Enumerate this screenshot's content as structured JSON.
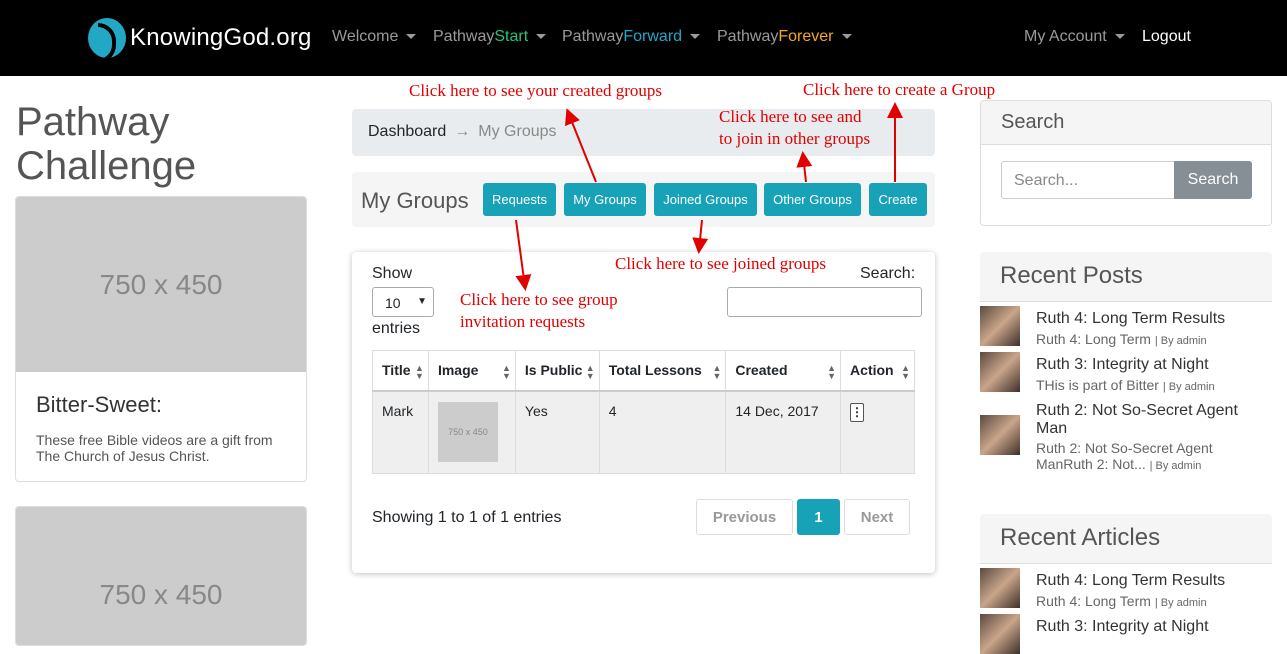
{
  "navbar": {
    "brand": "KnowingGod.org",
    "welcome": "Welcome",
    "pathway_start_prefix": "Pathway",
    "pathway_start_suffix": "Start",
    "pathway_forward_prefix": "Pathway",
    "pathway_forward_suffix": "Forward",
    "pathway_forever_prefix": "Pathway",
    "pathway_forever_suffix": "Forever",
    "my_account": "My Account",
    "logout": "Logout"
  },
  "left": {
    "title_line1": "Pathway",
    "title_line2": "Challenge",
    "card1_placeholder": "750 x 450",
    "card1_title": "Bitter-Sweet:",
    "card1_text": "These free Bible videos are a gift from The Church of Jesus Christ.",
    "card2_placeholder": "750 x 450"
  },
  "breadcrumb": {
    "dashboard": "Dashboard",
    "separator": "→",
    "current": "My Groups"
  },
  "groups_bar": {
    "title": "My Groups",
    "requests": "Requests",
    "my_groups": "My Groups",
    "joined_groups": "Joined Groups",
    "other_groups": "Other Groups",
    "create": "Create"
  },
  "table_controls": {
    "show": "Show",
    "page_size": "10",
    "entries": "entries",
    "search": "Search:"
  },
  "table": {
    "headers": [
      "Title",
      "Image",
      "Is Public",
      "Total Lessons",
      "Created",
      "Action"
    ],
    "rows": [
      {
        "title": "Mark",
        "image_placeholder": "750 x 450",
        "is_public": "Yes",
        "total_lessons": "4",
        "created": "14 Dec, 2017",
        "action": "⋮"
      }
    ]
  },
  "pagination": {
    "info": "Showing 1 to 1 of 1 entries",
    "previous": "Previous",
    "page": "1",
    "next": "Next"
  },
  "sidebar": {
    "search_title": "Search",
    "search_placeholder": "Search...",
    "search_button": "Search",
    "recent_posts_title": "Recent Posts",
    "posts": [
      {
        "title": "Ruth 4: Long Term Results",
        "sub": "Ruth 4: Long Term",
        "by": "| By admin"
      },
      {
        "title": "Ruth 3: Integrity at Night",
        "sub": "THis is part of Bitter",
        "by": "| By admin"
      },
      {
        "title": "Ruth 2: Not So-Secret Agent",
        "title2": "Man",
        "sub": "Ruth 2: Not So-Secret Agent",
        "sub2": "ManRuth 2: Not...",
        "by": "| By admin"
      }
    ],
    "recent_articles_title": "Recent Articles",
    "articles": [
      {
        "title": "Ruth 4: Long Term Results",
        "sub": "Ruth 4: Long Term",
        "by": "| By admin"
      },
      {
        "title": "Ruth 3: Integrity at Night"
      }
    ]
  },
  "annotations": {
    "created_groups": "Click here to see your created groups",
    "create_group": "Click here to create a Group",
    "other_groups_1": "Click here to see and",
    "other_groups_2": "to join in other groups",
    "joined_groups": "Click here to see joined groups",
    "requests_1": "Click here to see group",
    "requests_2": "invitation requests"
  },
  "colors": {
    "accent": "#17a2b8",
    "annotation": "#e00000",
    "start": "#2ec07b",
    "forward": "#20a8c8",
    "forever": "#f5a623"
  }
}
